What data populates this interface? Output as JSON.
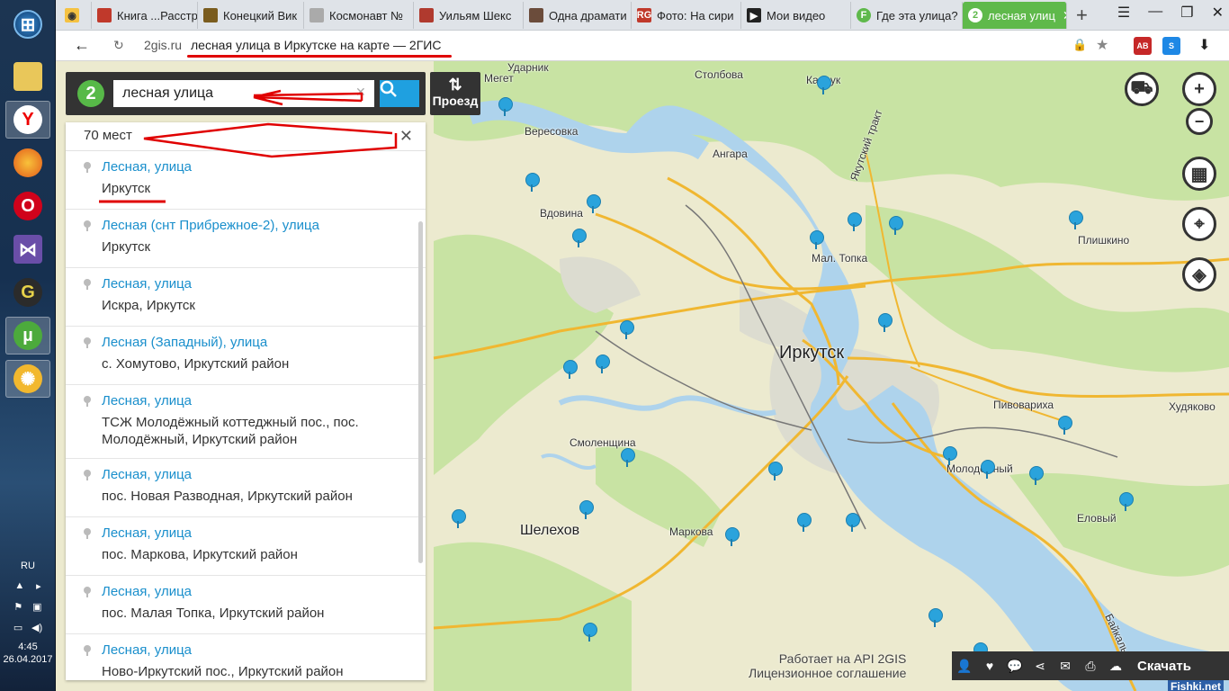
{
  "taskbar": {
    "icons": [
      "folder-icon",
      "yandex-browser-icon",
      "firefox-icon",
      "opera-icon",
      "visual-studio-icon",
      "app-icon",
      "utorrent-icon",
      "app-icon"
    ],
    "lang": "RU",
    "clock_time": "4:45",
    "clock_date": "26.04.2017"
  },
  "tabs": [
    {
      "label": "Книга ...Расстр",
      "fav": "#c0392b"
    },
    {
      "label": "Конецкий Вик",
      "fav": "#7a5c1e"
    },
    {
      "label": "Космонавт №",
      "fav": "#888"
    },
    {
      "label": "Уильям Шекс",
      "fav": "#b03a2e"
    },
    {
      "label": "Одна драмати",
      "fav": "#6b4c3b"
    },
    {
      "label": "Фото: На сири",
      "fav": "#c0392b"
    },
    {
      "label": "Мои видео",
      "fav": "#222"
    },
    {
      "label": "Где эта улица?",
      "fav": "#5fb94b"
    },
    {
      "label": "лесная улиц",
      "fav": "#5fb94b",
      "active": true
    }
  ],
  "address": {
    "domain": "2gis.ru",
    "title": "лесная улица в Иркутске на карте — 2ГИС"
  },
  "search": {
    "value": "лесная улица",
    "route_label": "Проезд"
  },
  "results": {
    "count_label": "70 мест",
    "items": [
      {
        "name": "Лесная, улица",
        "addr": "Иркутск"
      },
      {
        "name": "Лесная (снт Прибрежное-2), улица",
        "addr": "Иркутск"
      },
      {
        "name": "Лесная, улица",
        "addr": "Искра, Иркутск"
      },
      {
        "name": "Лесная (Западный), улица",
        "addr": "с. Хомутово, Иркутский район"
      },
      {
        "name": "Лесная, улица",
        "addr": "ТСЖ Молодёжный коттеджный пос., пос. Молодёжный, Иркутский район"
      },
      {
        "name": "Лесная, улица",
        "addr": "пос. Новая Разводная, Иркутский район"
      },
      {
        "name": "Лесная, улица",
        "addr": "пос. Маркова, Иркутский район"
      },
      {
        "name": "Лесная, улица",
        "addr": "пос. Малая Топка, Иркутский район"
      },
      {
        "name": "Лесная, улица",
        "addr": "Ново-Иркутский пос., Иркутский район"
      }
    ]
  },
  "map": {
    "labels": {
      "udarnik": "Ударник",
      "meget": "Мегет",
      "stolbova": "Столбова",
      "karluk": "Карлук",
      "verescovka": "Вересовка",
      "angara": "Ангара",
      "vdovina": "Вдовина",
      "yakutsky": "Якутский тракт",
      "plishkino": "Плишкино",
      "mal_topka": "Мал. Топка",
      "irkutsk": "Иркутск",
      "pivovarikha": "Пивовариха",
      "khudyakovo": "Худяково",
      "smolenshchina": "Смоленщина",
      "molodezhny": "Молодёжный",
      "shelekhov": "Шелехов",
      "markova": "Маркова",
      "elovy": "Еловый",
      "baikalsky": "Байкальский"
    }
  },
  "attribution": {
    "api": "Работает на API 2GIS",
    "license": "Лицензионное соглашение"
  },
  "bottombar": {
    "share_label": "Скачать"
  },
  "watermark": "Fishki.net"
}
